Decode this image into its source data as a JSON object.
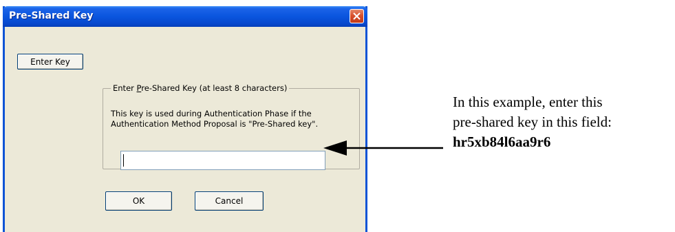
{
  "dialog": {
    "title": "Pre-Shared Key",
    "enter_key_button": "Enter Key",
    "group": {
      "legend_prefix": "Enter ",
      "legend_mnemonic": "P",
      "legend_suffix": "re-Shared Key (at least 8 characters)",
      "description_line1": "This key is used during Authentication Phase if the",
      "description_line2": "Authentication Method Proposal is \"Pre-Shared key\"."
    },
    "key_input_value": "",
    "ok_button": "OK",
    "cancel_button": "Cancel"
  },
  "annotation": {
    "line1": "In this example, enter this",
    "line2": "pre-shared key in this field:",
    "key_value": "hr5xb84l6aa9r6"
  },
  "colors": {
    "titlebar": "#0a55de",
    "dialog_bg": "#ece9d8",
    "close_button": "#d8512e"
  },
  "icons": {
    "close": "close-icon",
    "arrow": "left-arrow-icon"
  }
}
